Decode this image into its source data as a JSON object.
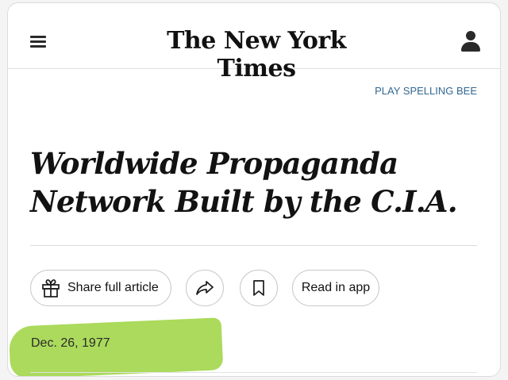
{
  "header": {
    "logo": "The New York Times",
    "menu_icon": "hamburger-menu-icon",
    "account_icon": "account-icon"
  },
  "promo": {
    "spelling_bee": "PLAY SPELLING BEE"
  },
  "article": {
    "headline_line1": "Worldwide Propaganda",
    "headline_line2": "Network Built by the C.I.A.",
    "date": "Dec. 26, 1977"
  },
  "actions": {
    "share_label": "Share full article",
    "share_icon": "gift-icon",
    "forward_icon": "share-arrow-icon",
    "bookmark_icon": "bookmark-icon",
    "read_in_app_label": "Read in app"
  },
  "colors": {
    "link_blue": "#326891",
    "highlight_green": "#9cd33f",
    "text_dark": "#121212"
  }
}
